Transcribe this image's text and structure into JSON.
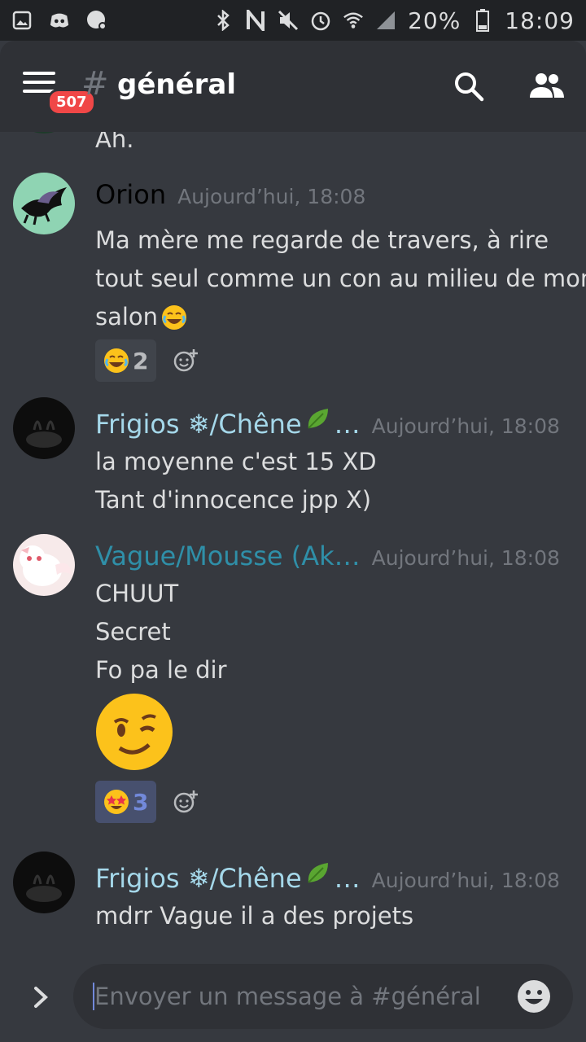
{
  "status_bar": {
    "battery": "20%",
    "time": "18:09",
    "icons": [
      "gallery-icon",
      "discord-icon",
      "notification-icon",
      "bluetooth-icon",
      "nfc-icon",
      "mute-icon",
      "alarm-icon",
      "wifi-icon",
      "signal-icon",
      "battery-icon"
    ]
  },
  "header": {
    "menu_badge": "507",
    "hash": "#",
    "channel": "général"
  },
  "messages": [
    {
      "partial_text": "Ah."
    },
    {
      "author": "Orion",
      "author_color": "#000000",
      "time": "Aujourd’hui, 18:08",
      "lines": [
        "Ma mère me regarde de travers, à rire",
        "tout seul comme un con au milieu de mon",
        "salon"
      ],
      "reaction": {
        "emoji": "joy",
        "count": "2"
      }
    },
    {
      "author": "Frigios ❄/Chêne",
      "author_suffix": "…",
      "author_color": "#a5d8ea",
      "time": "Aujourd’hui, 18:08",
      "lines": [
        "la moyenne c'est 15 XD",
        "Tant d'innocence jpp X)"
      ]
    },
    {
      "author": "Vague/Mousse (Ak…",
      "author_color": "#2f8fa8",
      "time": "Aujourd’hui, 18:08",
      "lines": [
        "CHUUT",
        "Secret",
        "Fo pa le dir"
      ],
      "big_emoji": "wink",
      "reaction": {
        "emoji": "star-struck",
        "count": "3"
      }
    },
    {
      "author": "Frigios ❄/Chêne",
      "author_suffix": "…",
      "author_color": "#a5d8ea",
      "time": "Aujourd’hui, 18:08",
      "lines": [
        "mdrr Vague il a des projets"
      ]
    }
  ],
  "composer": {
    "placeholder": "Envoyer un message à #général"
  }
}
